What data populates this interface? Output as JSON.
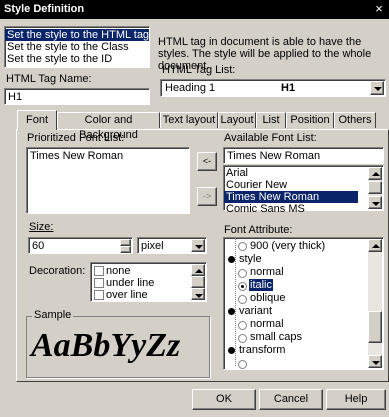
{
  "window": {
    "title": "Style Definition",
    "close_glyph": "×"
  },
  "scope_options": [
    "Set the style to the HTML tag",
    "Set the style to the Class",
    "Set the style to the ID"
  ],
  "scope_selected_index": 0,
  "scope_description": "HTML tag in document is able to have the styles. The style will be applied to the whole document.",
  "tag_name": {
    "label": "HTML Tag Name:",
    "value": "H1"
  },
  "tag_list": {
    "label": "HTML Tag List:",
    "name": "Heading 1",
    "tag": "H1"
  },
  "tabs": [
    "Font",
    "Color and Background",
    "Text layout",
    "Layout",
    "List",
    "Position",
    "Others"
  ],
  "active_tab": "Font",
  "prioritized_font": {
    "label": "Prioritized Font List:",
    "items": [
      "Times New Roman"
    ]
  },
  "transfer_buttons": {
    "add": "<-",
    "remove": "->"
  },
  "available_font": {
    "label": "Available Font List:",
    "value": "Times New Roman",
    "items": [
      "Arial",
      "Courier New",
      "Times New Roman",
      "Comic Sans MS"
    ],
    "selected": "Times New Roman"
  },
  "size": {
    "label": "Size:",
    "value": "60",
    "unit": "pixel"
  },
  "decoration": {
    "label": "Decoration:",
    "options": [
      "none",
      "under line",
      "over line"
    ]
  },
  "sample": {
    "label": "Sample",
    "text": "AaBbYyZz"
  },
  "font_attribute": {
    "label": "Font Attribute:",
    "rows": [
      {
        "kind": "option",
        "text": "900 (very thick)",
        "checked": false
      },
      {
        "kind": "group",
        "text": "style"
      },
      {
        "kind": "option",
        "text": "normal",
        "checked": false
      },
      {
        "kind": "option",
        "text": "italic",
        "checked": true
      },
      {
        "kind": "option",
        "text": "oblique",
        "checked": false
      },
      {
        "kind": "group",
        "text": "variant"
      },
      {
        "kind": "option",
        "text": "normal",
        "checked": false
      },
      {
        "kind": "option",
        "text": "small caps",
        "checked": false
      },
      {
        "kind": "group",
        "text": "transform"
      }
    ]
  },
  "buttons": {
    "ok": "OK",
    "cancel": "Cancel",
    "help": "Help"
  }
}
